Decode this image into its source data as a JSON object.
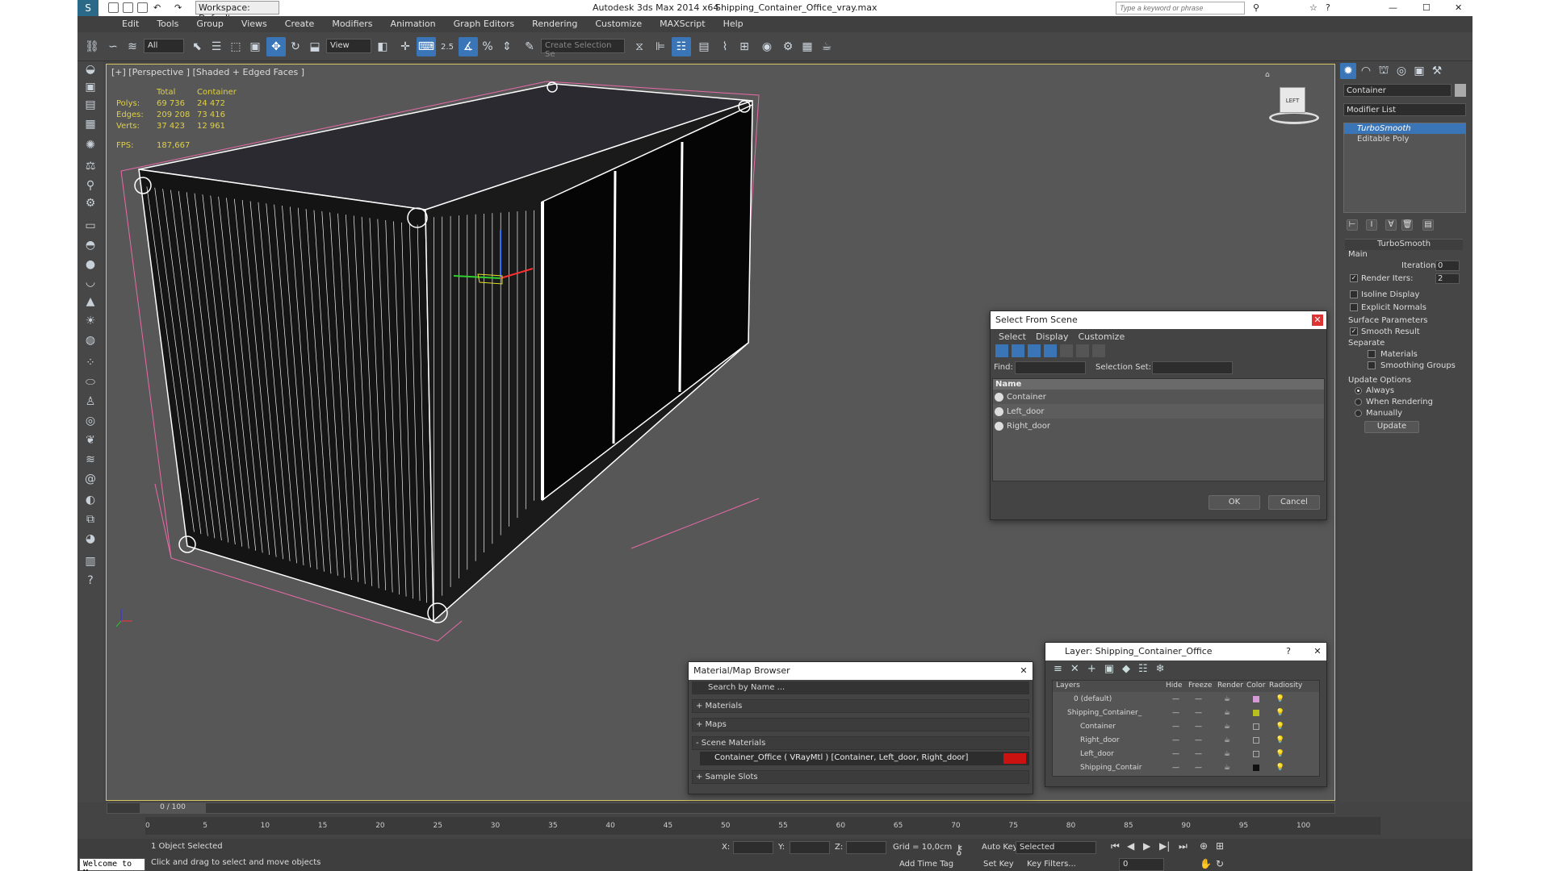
{
  "titlebar": {
    "workspace": "Workspace: Default",
    "app": "Autodesk 3ds Max  2014 x64",
    "file": "Shipping_Container_Office_vray.max",
    "search_placeholder": "Type a keyword or phrase"
  },
  "menu": [
    "Edit",
    "Tools",
    "Group",
    "Views",
    "Create",
    "Modifiers",
    "Animation",
    "Graph Editors",
    "Rendering",
    "Customize",
    "MAXScript",
    "Help"
  ],
  "toolbar": {
    "filter": "All",
    "refcoord": "View",
    "angle": "2.5",
    "selset": "Create Selection Se"
  },
  "viewport": {
    "label": "[+] [Perspective ] [Shaded + Edged Faces ]",
    "stats": {
      "col_total": "Total",
      "col_container": "Container",
      "rows": [
        {
          "k": "Polys:",
          "total": "69 736",
          "obj": "24 472"
        },
        {
          "k": "Edges:",
          "total": "209 208",
          "obj": "73 416"
        },
        {
          "k": "Verts:",
          "total": "37 423",
          "obj": "12 961"
        }
      ],
      "fps_label": "FPS:",
      "fps": "187,667"
    },
    "cube_label": "LEFT"
  },
  "cmdpanel": {
    "object_name": "Container",
    "modifier_list": "Modifier List",
    "stack": [
      "TurboSmooth",
      "Editable Poly"
    ],
    "turbosmooth": {
      "title": "TurboSmooth",
      "main": "Main",
      "iterations_label": "Iterations:",
      "iterations": "0",
      "render_iters_label": "Render Iters:",
      "render_iters": "2",
      "isoline": "Isoline Display",
      "explicit": "Explicit Normals",
      "surface": "Surface Parameters",
      "smooth_result": "Smooth Result",
      "separate": "Separate",
      "materials": "Materials",
      "smoothing": "Smoothing Groups",
      "update_options": "Update Options",
      "always": "Always",
      "when_rendering": "When Rendering",
      "manually": "Manually",
      "update": "Update"
    }
  },
  "select_dialog": {
    "title": "Select From Scene",
    "menu": [
      "Select",
      "Display",
      "Customize"
    ],
    "find_label": "Find:",
    "selset_label": "Selection Set:",
    "col_name": "Name",
    "items": [
      "Container",
      "Left_door",
      "Right_door"
    ],
    "ok": "OK",
    "cancel": "Cancel"
  },
  "material_browser": {
    "title": "Material/Map Browser",
    "search": "Search by Name ...",
    "sections": [
      "+ Materials",
      "+ Maps",
      "- Scene Materials"
    ],
    "material": "Container_Office  ( VRayMtl )  [Container, Left_door, Right_door]",
    "sample_slots": "+ Sample Slots",
    "swatch_color": "#cc1111"
  },
  "layer_dialog": {
    "title": "Layer: Shipping_Container_Office",
    "cols": [
      "Layers",
      "Hide",
      "Freeze",
      "Render",
      "Color",
      "Radiosity"
    ],
    "rows": [
      {
        "name": "0 (default)",
        "color": "#d49bd8"
      },
      {
        "name": "Shipping_Container_",
        "color": "#b8c020"
      },
      {
        "name": "Container",
        "color": "#444444"
      },
      {
        "name": "Right_door",
        "color": "#444444"
      },
      {
        "name": "Left_door",
        "color": "#444444"
      },
      {
        "name": "Shipping_Contair",
        "color": "#111111"
      }
    ]
  },
  "timeline": {
    "frame": "0 / 100",
    "ticks": [
      "0",
      "5",
      "10",
      "15",
      "20",
      "25",
      "30",
      "35",
      "40",
      "45",
      "50",
      "55",
      "60",
      "65",
      "70",
      "75",
      "80",
      "85",
      "90",
      "95",
      "100"
    ]
  },
  "status": {
    "maxscript": "Welcome to M",
    "selected": "1 Object Selected",
    "prompt": "Click and drag to select and move objects",
    "x": "X:",
    "y": "Y:",
    "z": "Z:",
    "grid": "Grid = 10,0cm",
    "add_time_tag": "Add Time Tag",
    "auto_key": "Auto Key",
    "selected_dd": "Selected",
    "set_key": "Set Key",
    "key_filters": "Key Filters...",
    "frame": "0"
  }
}
